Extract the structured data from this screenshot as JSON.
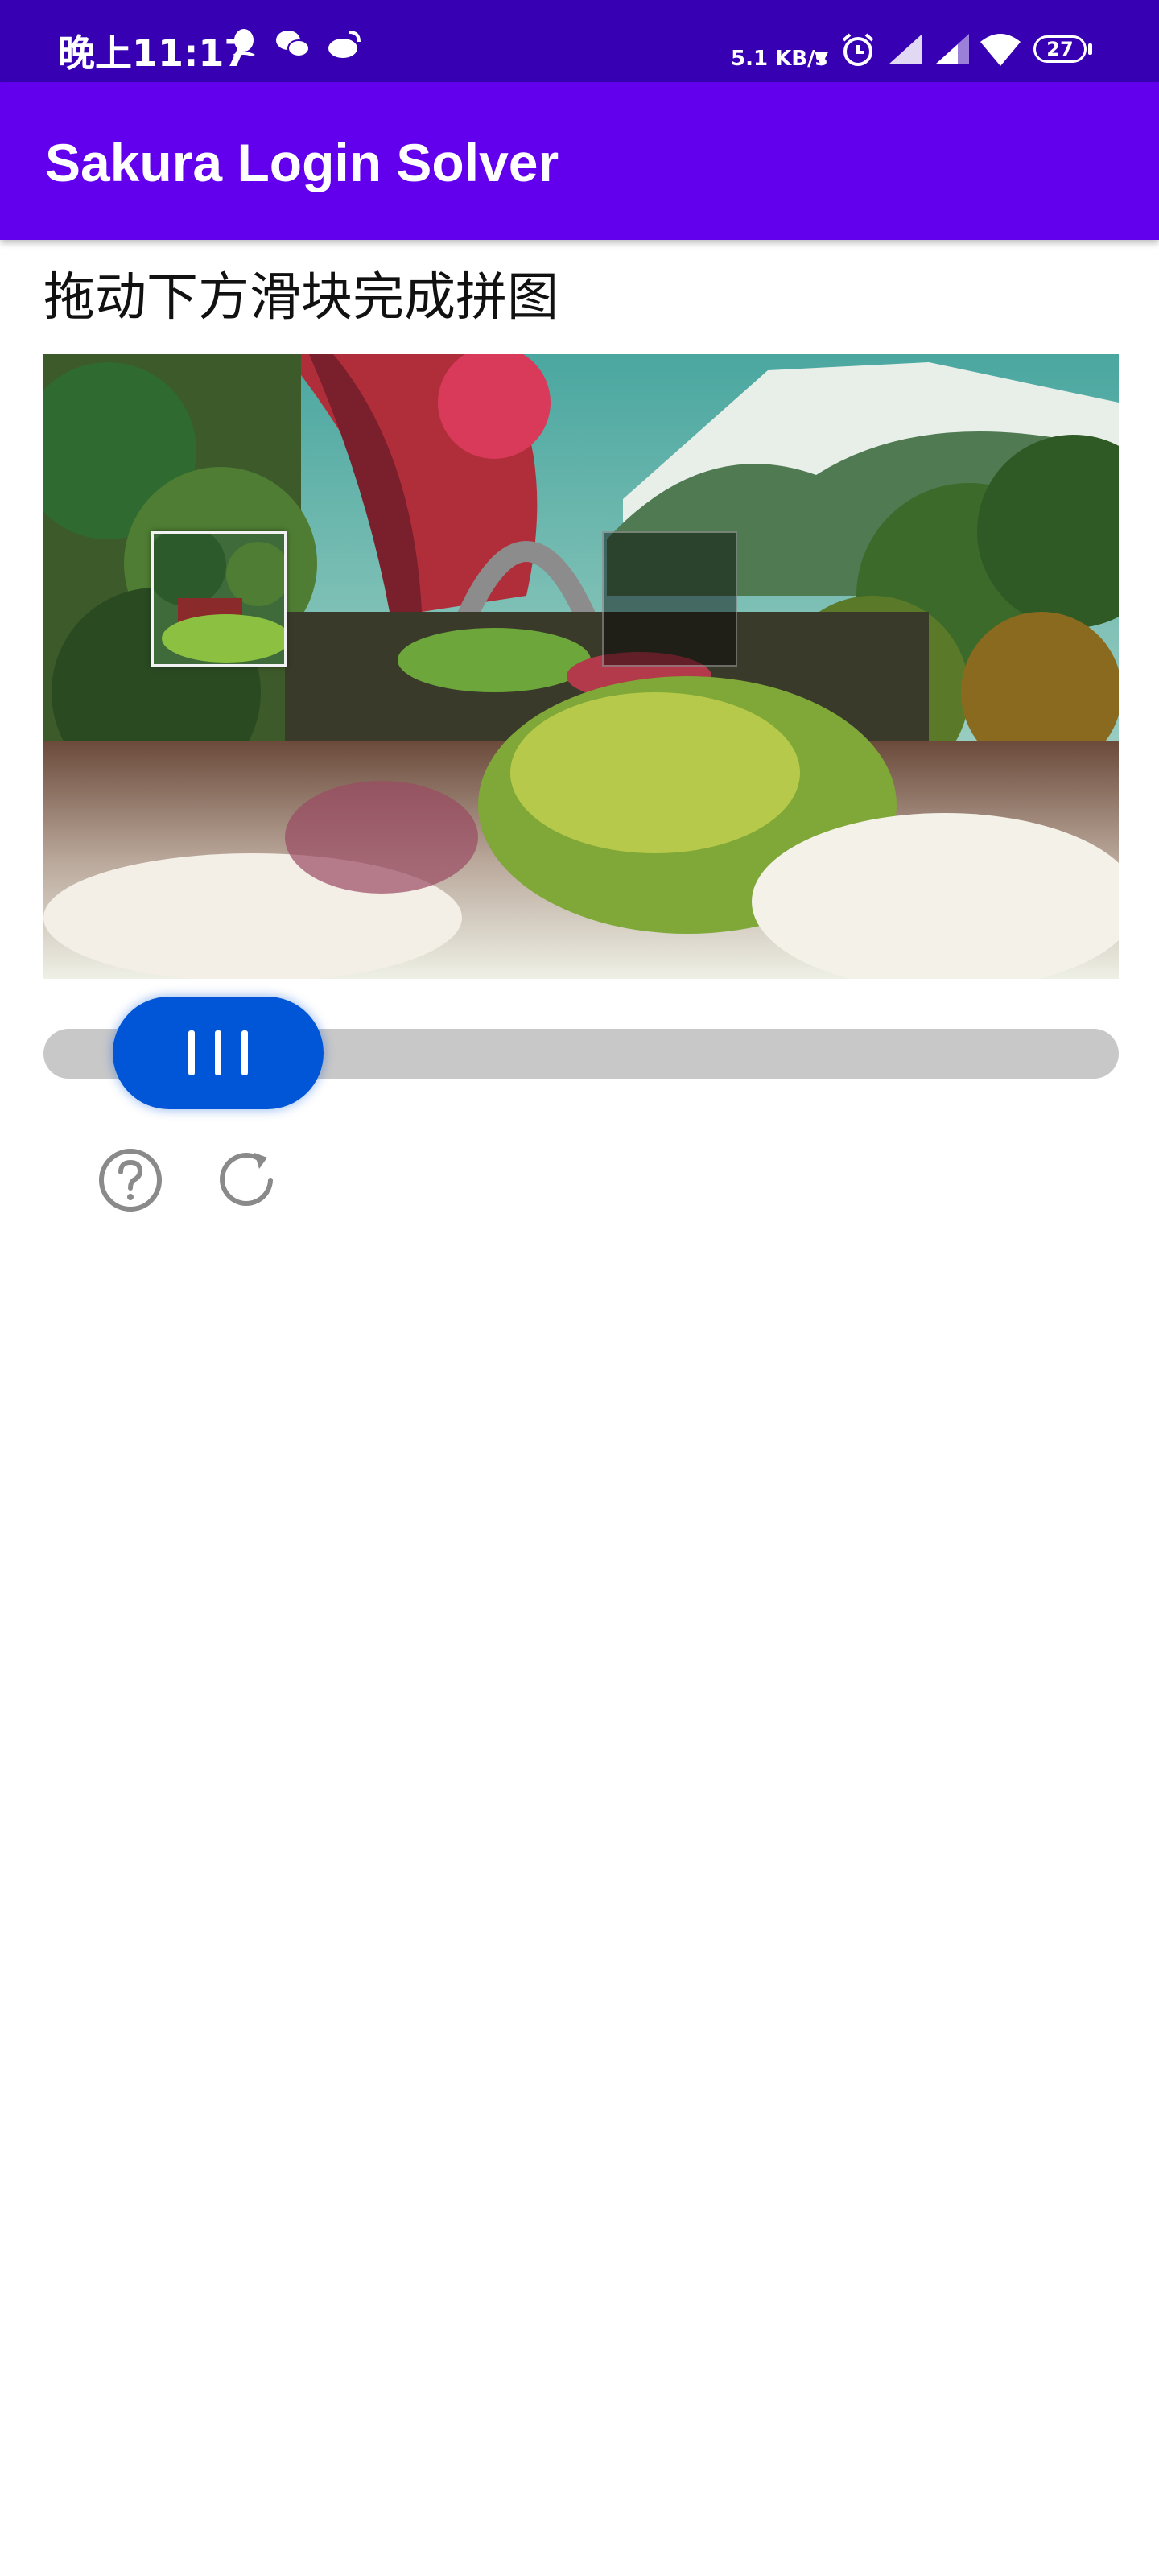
{
  "status_bar": {
    "time": "晚上11:17",
    "net_speed": "5.1 KB/s",
    "battery": "27",
    "icons": [
      "qq-icon",
      "wechat-icon",
      "weibo-icon",
      "alarm-icon",
      "signal-icon",
      "signal-icon-2",
      "wifi-icon",
      "battery-icon"
    ]
  },
  "app_bar": {
    "title": "Sakura Login Solver"
  },
  "captcha": {
    "instruction": "拖动下方滑块完成拼图",
    "slider_progress": 0.09,
    "icons": [
      "help-icon",
      "refresh-icon"
    ]
  },
  "colors": {
    "status_bar": "#3700b3",
    "app_bar": "#6200ee",
    "slider_thumb": "#0056d6",
    "slider_track": "#c8c8c8"
  }
}
